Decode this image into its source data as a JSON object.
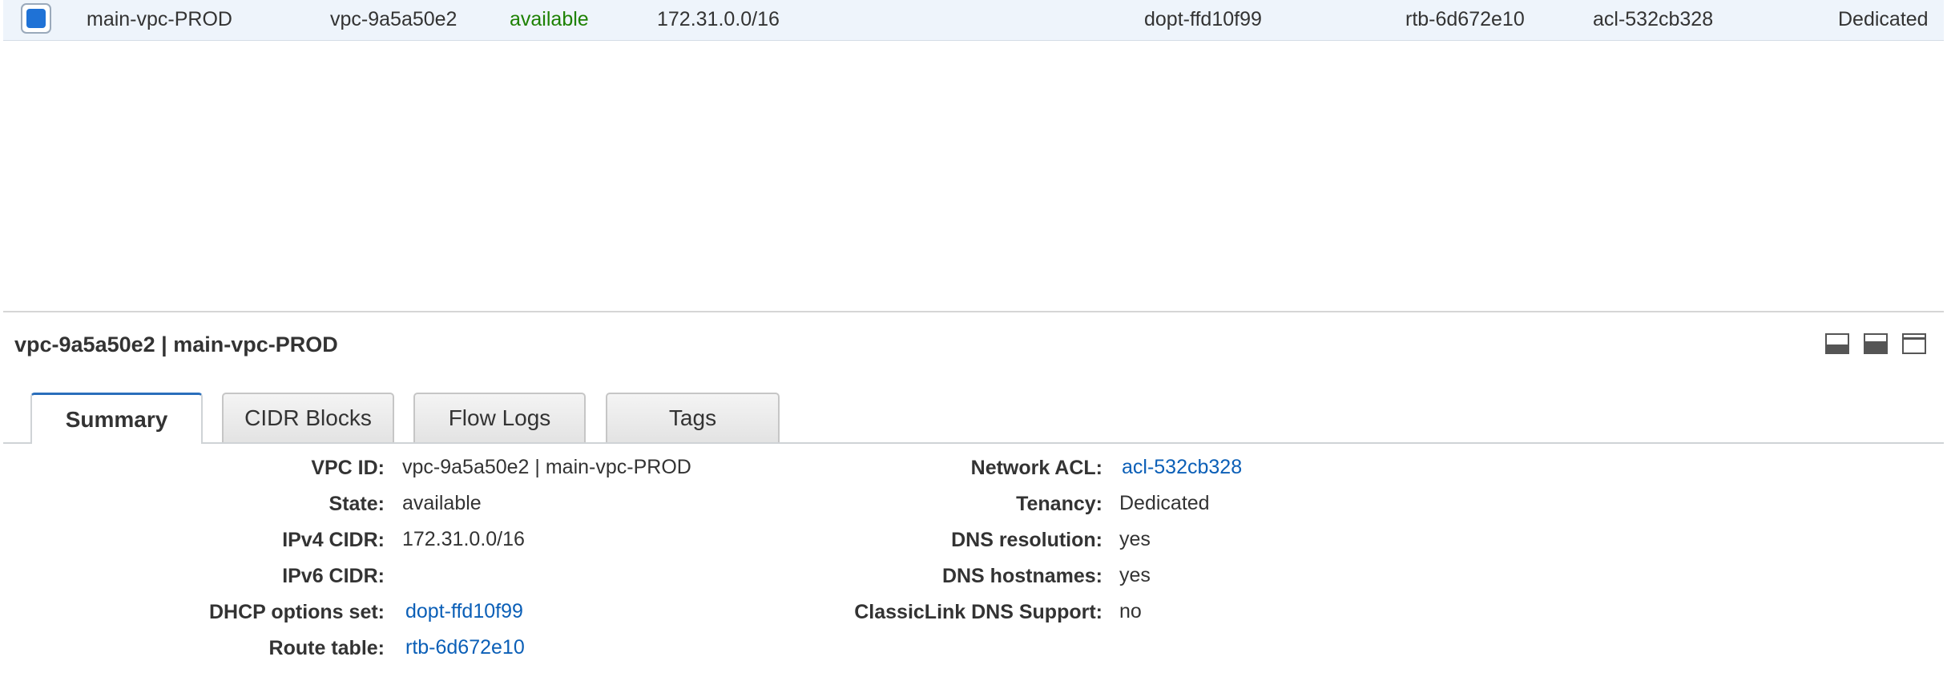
{
  "row": {
    "name": "main-vpc-PROD",
    "vpc_id": "vpc-9a5a50e2",
    "state": "available",
    "ipv4_cidr": "172.31.0.0/16",
    "dhcp_options_set": "dopt-ffd10f99",
    "route_table": "rtb-6d672e10",
    "network_acl": "acl-532cb328",
    "tenancy": "Dedicated",
    "selected": true,
    "state_color": "#1d8102"
  },
  "detail": {
    "title": "vpc-9a5a50e2 | main-vpc-PROD",
    "panel_icons": [
      "panel-bottom-small-icon",
      "panel-bottom-medium-icon",
      "panel-bottom-large-icon"
    ]
  },
  "tabs": [
    {
      "label": "Summary",
      "active": true
    },
    {
      "label": "CIDR Blocks",
      "active": false
    },
    {
      "label": "Flow Logs",
      "active": false
    },
    {
      "label": "Tags",
      "active": false
    }
  ],
  "summary": {
    "left": [
      {
        "label": "VPC ID:",
        "value": "vpc-9a5a50e2 | main-vpc-PROD"
      },
      {
        "label": "State:",
        "value": "available"
      },
      {
        "label": "IPv4 CIDR:",
        "value": "172.31.0.0/16"
      },
      {
        "label": "IPv6 CIDR:",
        "value": ""
      },
      {
        "label": "DHCP options set:",
        "value": "dopt-ffd10f99"
      },
      {
        "label": "Route table:",
        "value": "rtb-6d672e10"
      }
    ],
    "right": [
      {
        "label": "Network ACL:",
        "value": "acl-532cb328"
      },
      {
        "label": "Tenancy:",
        "value": "Dedicated"
      },
      {
        "label": "DNS resolution:",
        "value": "yes"
      },
      {
        "label": "DNS hostnames:",
        "value": "yes"
      },
      {
        "label": "ClassicLink DNS Support:",
        "value": "no"
      }
    ]
  },
  "colors": {
    "link": "#0b5fb7",
    "tab_accent": "#2a6ebb",
    "selected_row": "#eef4fb"
  }
}
